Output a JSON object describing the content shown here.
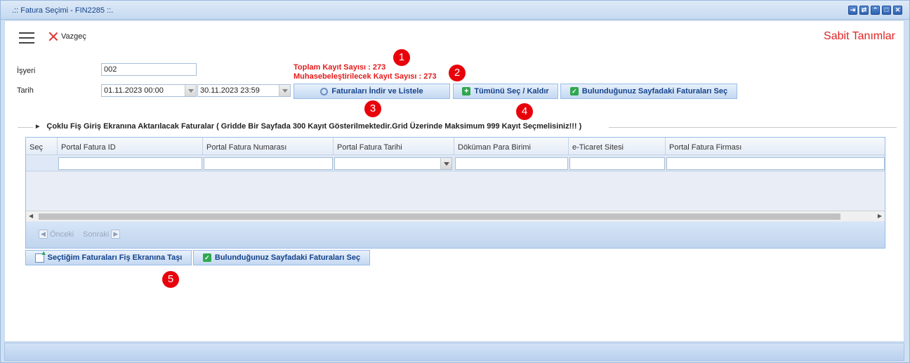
{
  "window": {
    "title": ".:: Fatura Seçimi - FIN2285 ::.",
    "controls": [
      "⇥",
      "⇄",
      "⌃",
      "□",
      "✕"
    ]
  },
  "toolbar": {
    "cancel_label": "Vazgeç",
    "right_title": "Sabit Tanımlar"
  },
  "form": {
    "isyeri_label": "İşyeri",
    "isyeri_value": "002",
    "tarih_label": "Tarih",
    "date_from": "01.11.2023 00:00",
    "date_to": "30.11.2023 23:59"
  },
  "info": {
    "total_records": "Toplam Kayıt Sayısı : 273",
    "accounting_records": "Muhasebeleştirilecek Kayıt Sayısı : 273"
  },
  "buttons": {
    "download_list": "Faturaları İndir ve Listele",
    "select_all": "Tümünü Seç / Kaldır",
    "select_page": "Bulunduğunuz Sayfadaki Faturaları Seç",
    "move_selected": "Seçtiğim Faturaları Fiş Ekranına Taşı",
    "select_page_bottom": "Bulunduğunuz Sayfadaki Faturaları Seç"
  },
  "badges": [
    "1",
    "2",
    "3",
    "4",
    "5"
  ],
  "section": {
    "title": "Çoklu Fiş Giriş Ekranına Aktarılacak Faturalar ( Gridde Bir Sayfada 300 Kayıt Gösterilmektedir.Grid Üzerinde Maksimum 999 Kayıt Seçmelisiniz!!! )"
  },
  "grid": {
    "columns": [
      "Seç",
      "Portal Fatura ID",
      "Portal Fatura Numarası",
      "Portal Fatura Tarihi",
      "Döküman Para Birimi",
      "e-Ticaret Sitesi",
      "Portal Fatura Firması"
    ]
  },
  "pager": {
    "prev": "Önceki",
    "next": "Sonraki"
  },
  "colors": {
    "accent_red": "#e02424",
    "badge_red": "#e8000b",
    "button_text": "#15428b"
  }
}
